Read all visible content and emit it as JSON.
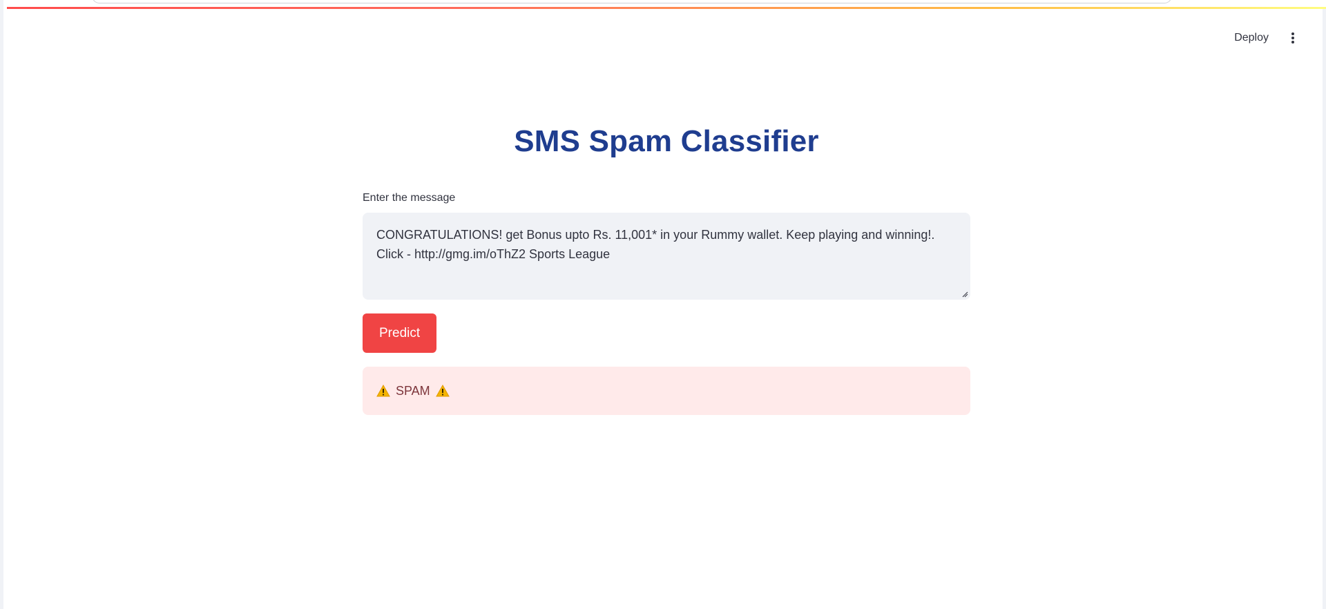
{
  "header": {
    "deploy_label": "Deploy",
    "menu_icon": "more-vertical-icon"
  },
  "main": {
    "title": "SMS Spam Classifier",
    "input_label": "Enter the message",
    "message_value": "CONGRATULATIONS! get Bonus upto Rs. 11,001* in your Rummy wallet. Keep playing and winning!.\nClick - http://gmg.im/oThZ2 Sports League",
    "predict_label": "Predict",
    "result": {
      "icon": "warning-icon",
      "label": "SPAM"
    }
  },
  "colors": {
    "title": "#1f3d8f",
    "button": "#f04444",
    "result_bg": "#ffeaea",
    "result_text": "#7d353b",
    "input_bg": "#f0f2f6"
  }
}
